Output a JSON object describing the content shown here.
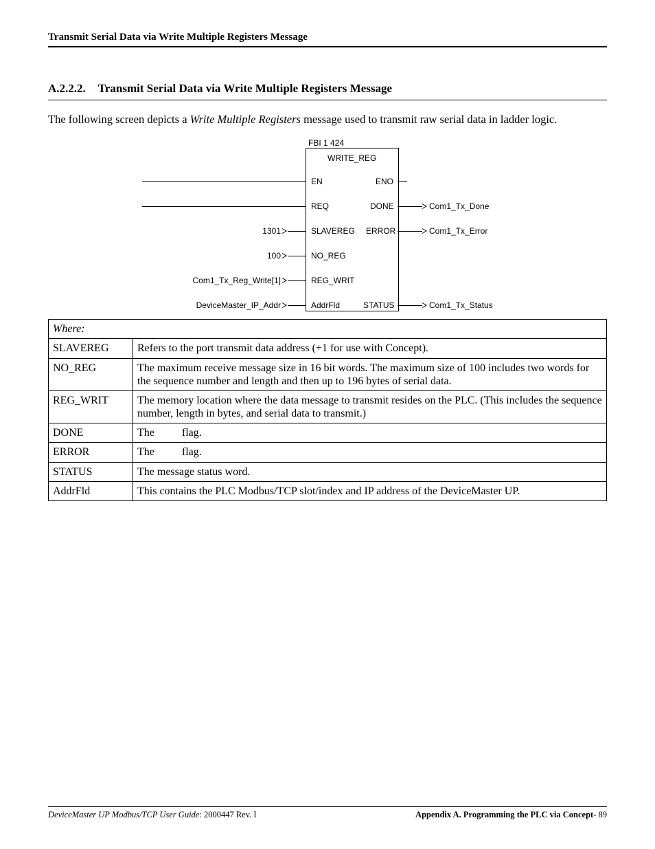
{
  "header": {
    "running_title": "Transmit Serial Data via Write Multiple Registers Message"
  },
  "section": {
    "number": "A.2.2.2.",
    "title": "Transmit Serial Data via Write Multiple Registers Message"
  },
  "intro": {
    "pre": "The following screen depicts a ",
    "italic": "Write Multiple Registers",
    "post": " message used to transmit raw serial data in ladder logic."
  },
  "diagram": {
    "block_id": "FBI 1 424",
    "block_title": "WRITE_REG",
    "ports": {
      "en": "EN",
      "eno": "ENO",
      "req": "REQ",
      "done": "DONE",
      "slavereg": "SLAVEREG",
      "error": "ERROR",
      "no_reg": "NO_REG",
      "reg_writ": "REG_WRIT",
      "addrfld": "AddrFld",
      "status": "STATUS"
    },
    "inputs": {
      "slavereg": "1301",
      "no_reg": "100",
      "reg_writ": "Com1_Tx_Reg_Write[1]",
      "addrfld": "DeviceMaster_IP_Addr"
    },
    "outputs": {
      "done": "Com1_Tx_Done",
      "error": "Com1_Tx_Error",
      "status": "Com1_Tx_Status"
    }
  },
  "definitions": {
    "where": "Where:",
    "rows": [
      {
        "key": "SLAVEREG",
        "val": "Refers to the port transmit data address (+1 for use with Concept)."
      },
      {
        "key": "NO_REG",
        "val": "The maximum receive message size in 16 bit words. The maximum size of 100 includes two words for the sequence number and length and then up to 196 bytes of serial data."
      },
      {
        "key": "REG_WRIT",
        "val": "The memory location where the data message to transmit resides on the PLC. (This includes the sequence number, length in bytes, and serial data to transmit.)"
      },
      {
        "key": "DONE",
        "val_pre": "The",
        "val_post": "flag."
      },
      {
        "key": "ERROR",
        "val_pre": "The",
        "val_post": "flag."
      },
      {
        "key": "STATUS",
        "val": "The message status word."
      },
      {
        "key": "AddrFld",
        "val": "This contains the PLC Modbus/TCP slot/index and IP address of the DeviceMaster UP."
      }
    ]
  },
  "footer": {
    "left_italic": "DeviceMaster UP Modbus/TCP User Guide",
    "left_rest": ": 2000447 Rev. I",
    "right_bold": "Appendix A. Programming the PLC via Concept",
    "right_page": "- 89"
  }
}
